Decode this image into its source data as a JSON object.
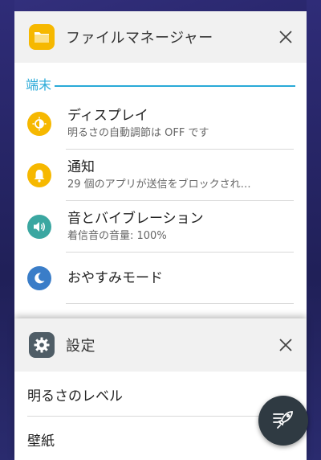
{
  "recent_apps": [
    {
      "title": "ファイルマネージャー",
      "icon": "folder-icon",
      "section_header": "端末",
      "items": [
        {
          "title": "ディスプレイ",
          "subtitle": "明るさの自動調節は OFF です",
          "icon": "brightness-icon",
          "icon_color": "#f6b800"
        },
        {
          "title": "通知",
          "subtitle": "29 個のアプリが送信をブロックされ…",
          "icon": "bell-icon",
          "icon_color": "#f6b800"
        },
        {
          "title": "音とバイブレーション",
          "subtitle": "着信音の音量: 100%",
          "icon": "speaker-icon",
          "icon_color": "#3ba7a1"
        },
        {
          "title": "おやすみモード",
          "subtitle": "",
          "icon": "moon-icon",
          "icon_color": "#3a7dc8"
        }
      ]
    },
    {
      "title": "設定",
      "icon": "gear-icon",
      "items": [
        {
          "title": "明るさのレベル"
        },
        {
          "title": "壁紙"
        }
      ]
    }
  ],
  "colors": {
    "accent": "#2aaad8",
    "background": "#252467",
    "fab": "#2f3a42"
  },
  "fab_icon": "clear-all-rocket-icon"
}
